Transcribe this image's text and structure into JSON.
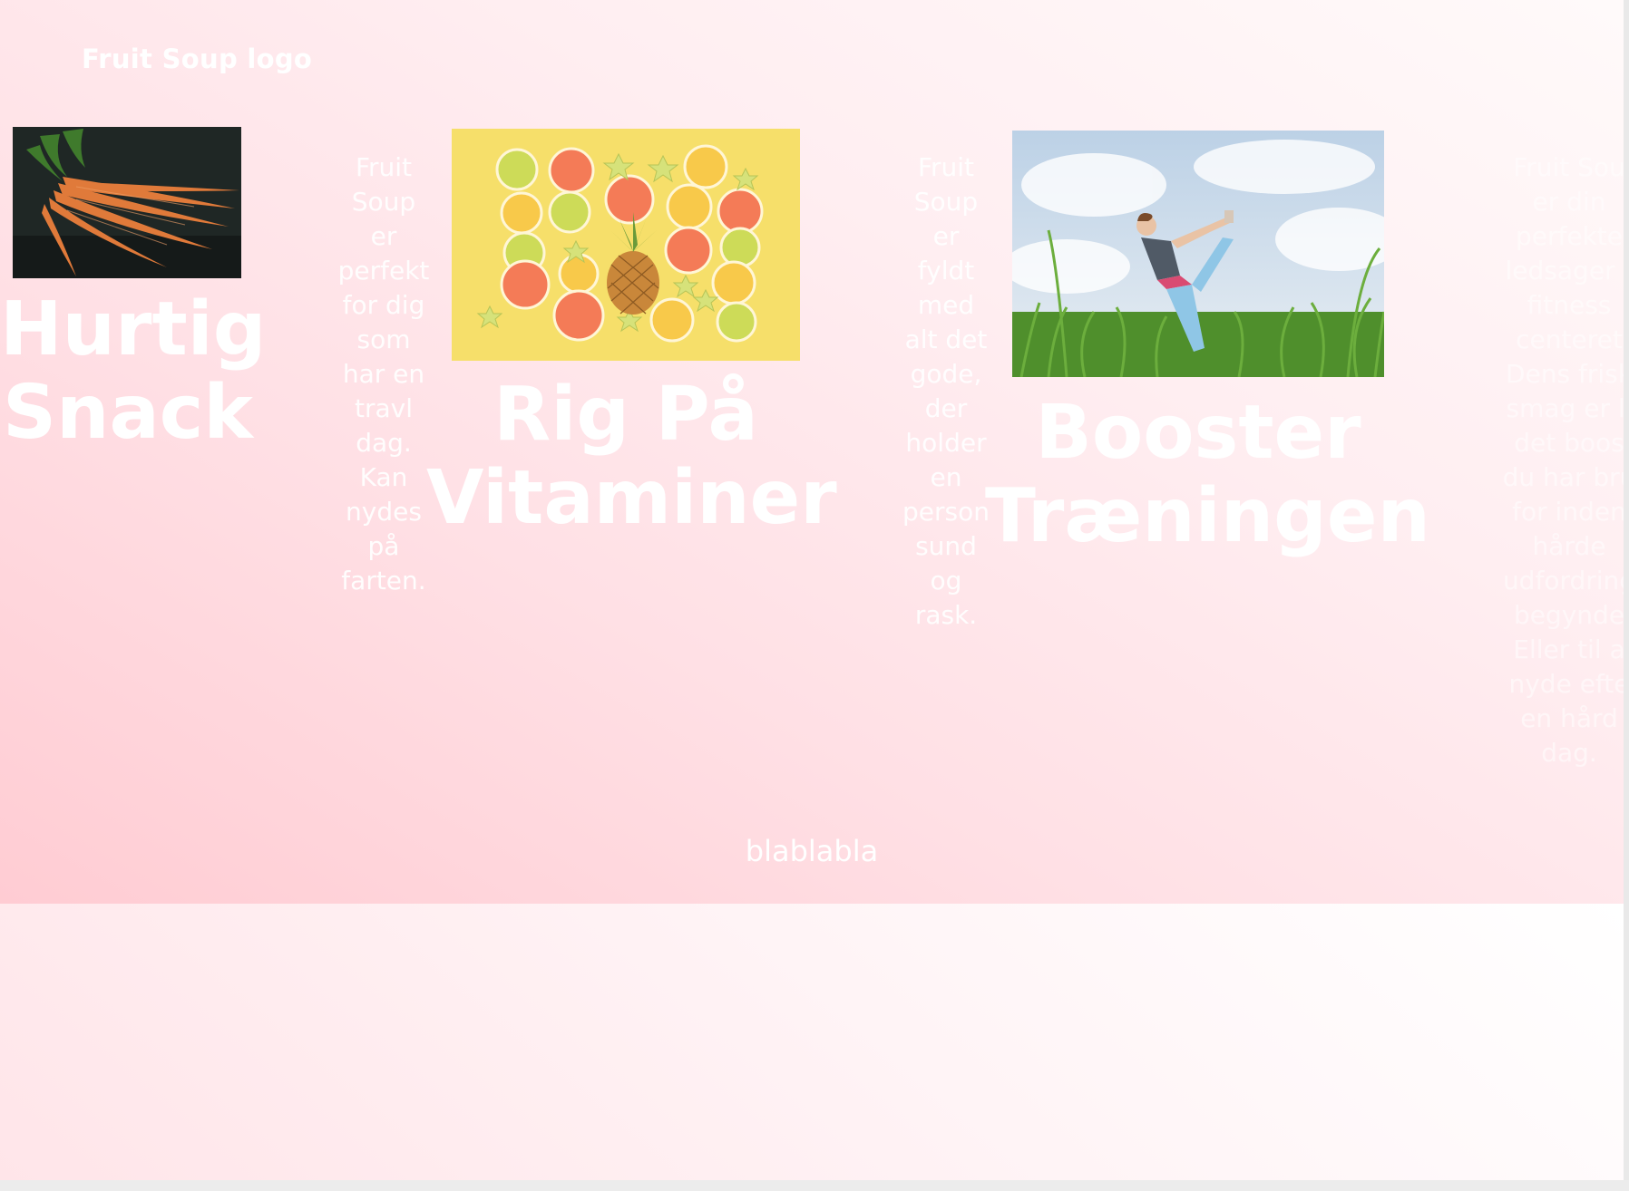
{
  "header": {
    "logo_text": "Fruit Soup logo"
  },
  "products": [
    {
      "title": "Hurtig\nSnack",
      "image_alt": "carrots",
      "description": "Fruit\nSoup\ner\nperfekt\nfor dig\nsom\nhar en\ntravl\ndag.\nKan\nnydes\npå\nfarten."
    },
    {
      "title": "Rig På\nVitaminer",
      "image_alt": "citrus slices and pineapple",
      "description": "Fruit\nSoup\ner\nfyldt\nmed\nalt det\ngode,\nder\nholder\nen\nperson\nsund\nog\nrask."
    },
    {
      "title": "Booster\nTræningen",
      "image_alt": "woman doing yoga in a field",
      "description": "Fruit Sou\ner din\nperfekte\nledsager t\nfitness\ncenteret\nDens frisk\nsmag er li\ndet boos\ndu har bru\nfor inden \nhårde\nudfordring\nbegynde\nEller til a\nnyde efte\nen hård\ndag."
    }
  ],
  "footer": {
    "text": "blablabla"
  },
  "colors": {
    "text": "#ffffff",
    "bg_pink": "#ffd6dc"
  }
}
